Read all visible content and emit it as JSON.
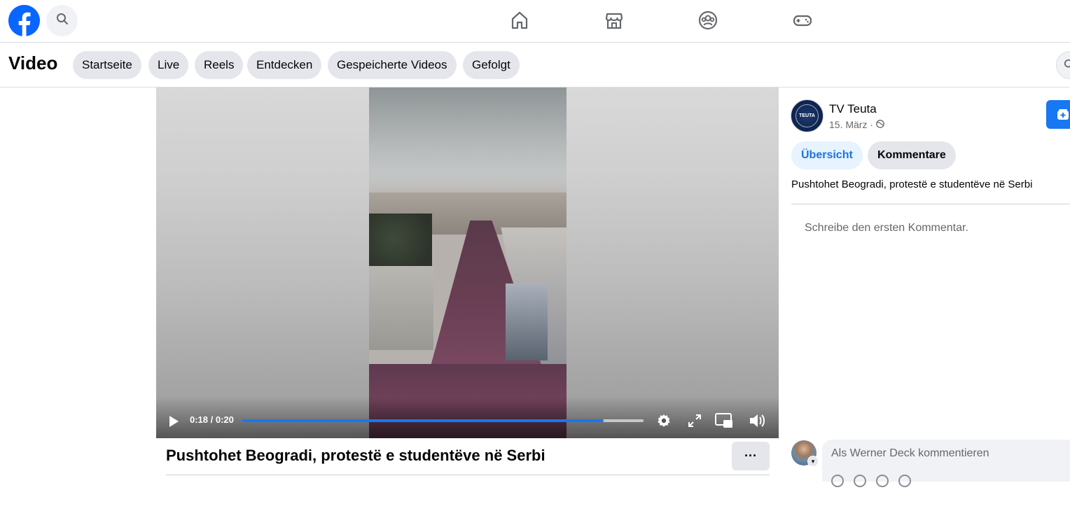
{
  "topbar": {
    "icons": [
      "facebook-logo",
      "search-icon",
      "home-icon",
      "marketplace-icon",
      "groups-icon",
      "gaming-icon"
    ]
  },
  "subnav": {
    "title": "Video",
    "tabs": [
      "Startseite",
      "Live",
      "Reels",
      "Entdecken",
      "Gespeicherte Videos",
      "Gefolgt"
    ]
  },
  "player": {
    "time": "0:18 / 0:20",
    "progress": 0.9,
    "icons": [
      "play-icon",
      "settings-icon",
      "fullscreen-icon",
      "picture-in-picture-icon",
      "volume-icon"
    ]
  },
  "video": {
    "title": "Pushtohet Beogradi, protestë e studentëve në Serbi",
    "more_label": "···"
  },
  "post": {
    "page_name": "TV Teuta",
    "avatar_text": "TEUTA",
    "date": "15. März ·",
    "tabs": {
      "overview": "Übersicht",
      "comments": "Kommentare"
    },
    "description": "Pushtohet Beogradi, protestë e studentëve në Serbi",
    "no_comments": "Schreibe den ersten Kommentar.",
    "comment_placeholder": "Als Werner Deck kommentieren"
  },
  "colors": {
    "brand": "#1877f2",
    "pill_bg": "#e4e6eb",
    "active_tab_bg": "#e7f3ff",
    "active_tab_text": "#1b74e4"
  }
}
